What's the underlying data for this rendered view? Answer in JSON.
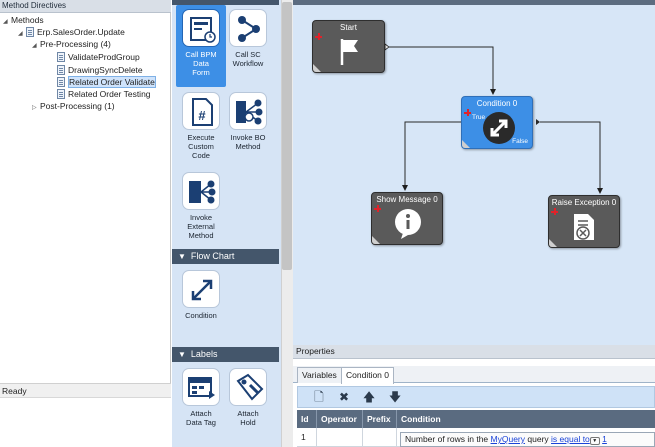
{
  "left_panel": {
    "title": "Method Directives",
    "tree": {
      "root": "Methods",
      "method": "Erp.SalesOrder.Update",
      "pre_processing": "Pre-Processing (4)",
      "directives": [
        "ValidateProdGroup",
        "DrawingSyncDelete",
        "Related Order Validate",
        "Related Order Testing"
      ],
      "post_processing": "Post-Processing (1)"
    },
    "status": "Ready"
  },
  "palette": {
    "sections": [
      {
        "label": "Flow Chart"
      },
      {
        "label": "Labels"
      }
    ],
    "setter_tools": [
      {
        "label": "Call BPM\nData\nForm",
        "icon": "bpm-form-icon",
        "active": true
      },
      {
        "label": "Call SC\nWorkflow",
        "icon": "workflow-icon",
        "active": false
      },
      {
        "label": "Execute\nCustom\nCode",
        "icon": "custom-code-icon",
        "active": false
      },
      {
        "label": "Invoke BO\nMethod",
        "icon": "bo-method-icon",
        "active": false
      },
      {
        "label": "Invoke\nExternal\nMethod",
        "icon": "external-method-icon",
        "active": false
      }
    ],
    "flow_tools": [
      {
        "label": "Condition",
        "icon": "condition-icon"
      }
    ],
    "label_tools": [
      {
        "label": "Attach\nData Tag",
        "icon": "data-tag-icon"
      },
      {
        "label": "Attach\nHold",
        "icon": "hold-icon"
      }
    ]
  },
  "canvas": {
    "nodes": {
      "start": {
        "title": "Start"
      },
      "condition": {
        "title": "Condition 0",
        "true_label": "True",
        "false_label": "False"
      },
      "show_message": {
        "title": "Show Message 0"
      },
      "raise_exception": {
        "title": "Raise Exception 0"
      }
    }
  },
  "properties": {
    "title": "Properties",
    "tabs": [
      "Variables",
      "Condition 0"
    ],
    "active_tab": "Condition 0",
    "columns": [
      "Id",
      "Operator",
      "Prefix",
      "Condition"
    ],
    "rows": [
      {
        "id": "1",
        "operator": "",
        "prefix": "",
        "condition_prefix": "Number of rows in the",
        "condition_query": "MyQuery",
        "condition_mid": "query",
        "condition_op": "is equal to",
        "condition_value": "1"
      }
    ]
  },
  "colors": {
    "palette_bg": "#d6e4f5",
    "header_dark": "#44566b",
    "active_blue": "#3d8fe6",
    "node_dark": "#5a5a5a",
    "canvas_bg": "#d7e6f7"
  }
}
